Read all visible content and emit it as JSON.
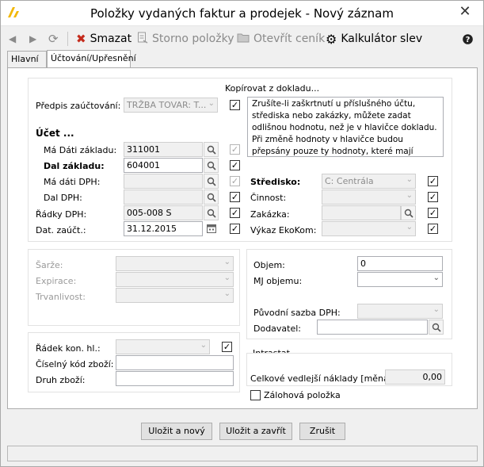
{
  "window": {
    "title": "Položky vydaných faktur a prodejek - Nový záznam",
    "close": "✕"
  },
  "toolbar": {
    "delete": "Smazat",
    "storno": "Storno položky",
    "open_pricelist": "Otevřít ceník",
    "discount_calc": "Kalkulátor slev"
  },
  "tabs": {
    "main": "Hlavní",
    "accounting": "Účtování/Upřesnění"
  },
  "accounting": {
    "predpis_label": "Předpis zaúčtování:",
    "predpis_value": "TRŽBA TOVAR: T...",
    "ucet_heading": "Účet ...",
    "md_zaklad_label": "Má Dáti základu:",
    "md_zaklad_value": "311001",
    "dal_zaklad_label": "Dal základu:",
    "dal_zaklad_value": "604001",
    "md_dph_label": "Má dáti DPH:",
    "md_dph_value": "",
    "dal_dph_label": "Dal DPH:",
    "dal_dph_value": "",
    "radky_dph_label": "Řádky DPH:",
    "radky_dph_value": "005-008 S",
    "dat_zauct_label": "Dat. zaúčt.:",
    "dat_zauct_value": "31.12.2015"
  },
  "copy": {
    "heading": "Kopírovat z dokladu...",
    "note": "Zrušíte-li zaškrtnutí u příslušného účtu, střediska nebo zakázky, můžete zadat odlišnou hodnotu, než je v hlavičce dokladu. Při změně hodnoty v hlavičce budou přepsány pouze ty hodnoty, které mají zaškrtnuto \"Kopírovat z..."
  },
  "center": {
    "stredisko_label": "Středisko:",
    "stredisko_value": "C: Centrála",
    "cinnost_label": "Činnost:",
    "zakazka_label": "Zakázka:",
    "vykaz_label": "Výkaz EkoKom:"
  },
  "batch": {
    "sarze": "Šarže:",
    "expirace": "Expirace:",
    "trvanlivost": "Trvanlivost:"
  },
  "volume": {
    "objem_label": "Objem:",
    "objem_value": "0",
    "mj_label": "MJ objemu:",
    "puvodni_sazba_label": "Původní sazba DPH:",
    "dodavatel_label": "Dodavatel:"
  },
  "customs": {
    "radek_label": "Řádek kon. hl.:",
    "ciselny_kod_label": "Číselný kód zboží:",
    "druh_label": "Druh zboží:"
  },
  "intrastat": {
    "heading": "Intrastat",
    "naklady_label": "Celkové vedlejší náklady [měna]:",
    "naklady_value": "0,00",
    "zalohova_label": "Zálohová položka"
  },
  "buttons": {
    "save_new": "Uložit a nový",
    "save_close": "Uložit a zavřít",
    "cancel": "Zrušit"
  },
  "colors": {
    "delete_icon": "#c42b1c",
    "app_icon": "#f2b705",
    "disabled_text": "#9a9a9a"
  }
}
